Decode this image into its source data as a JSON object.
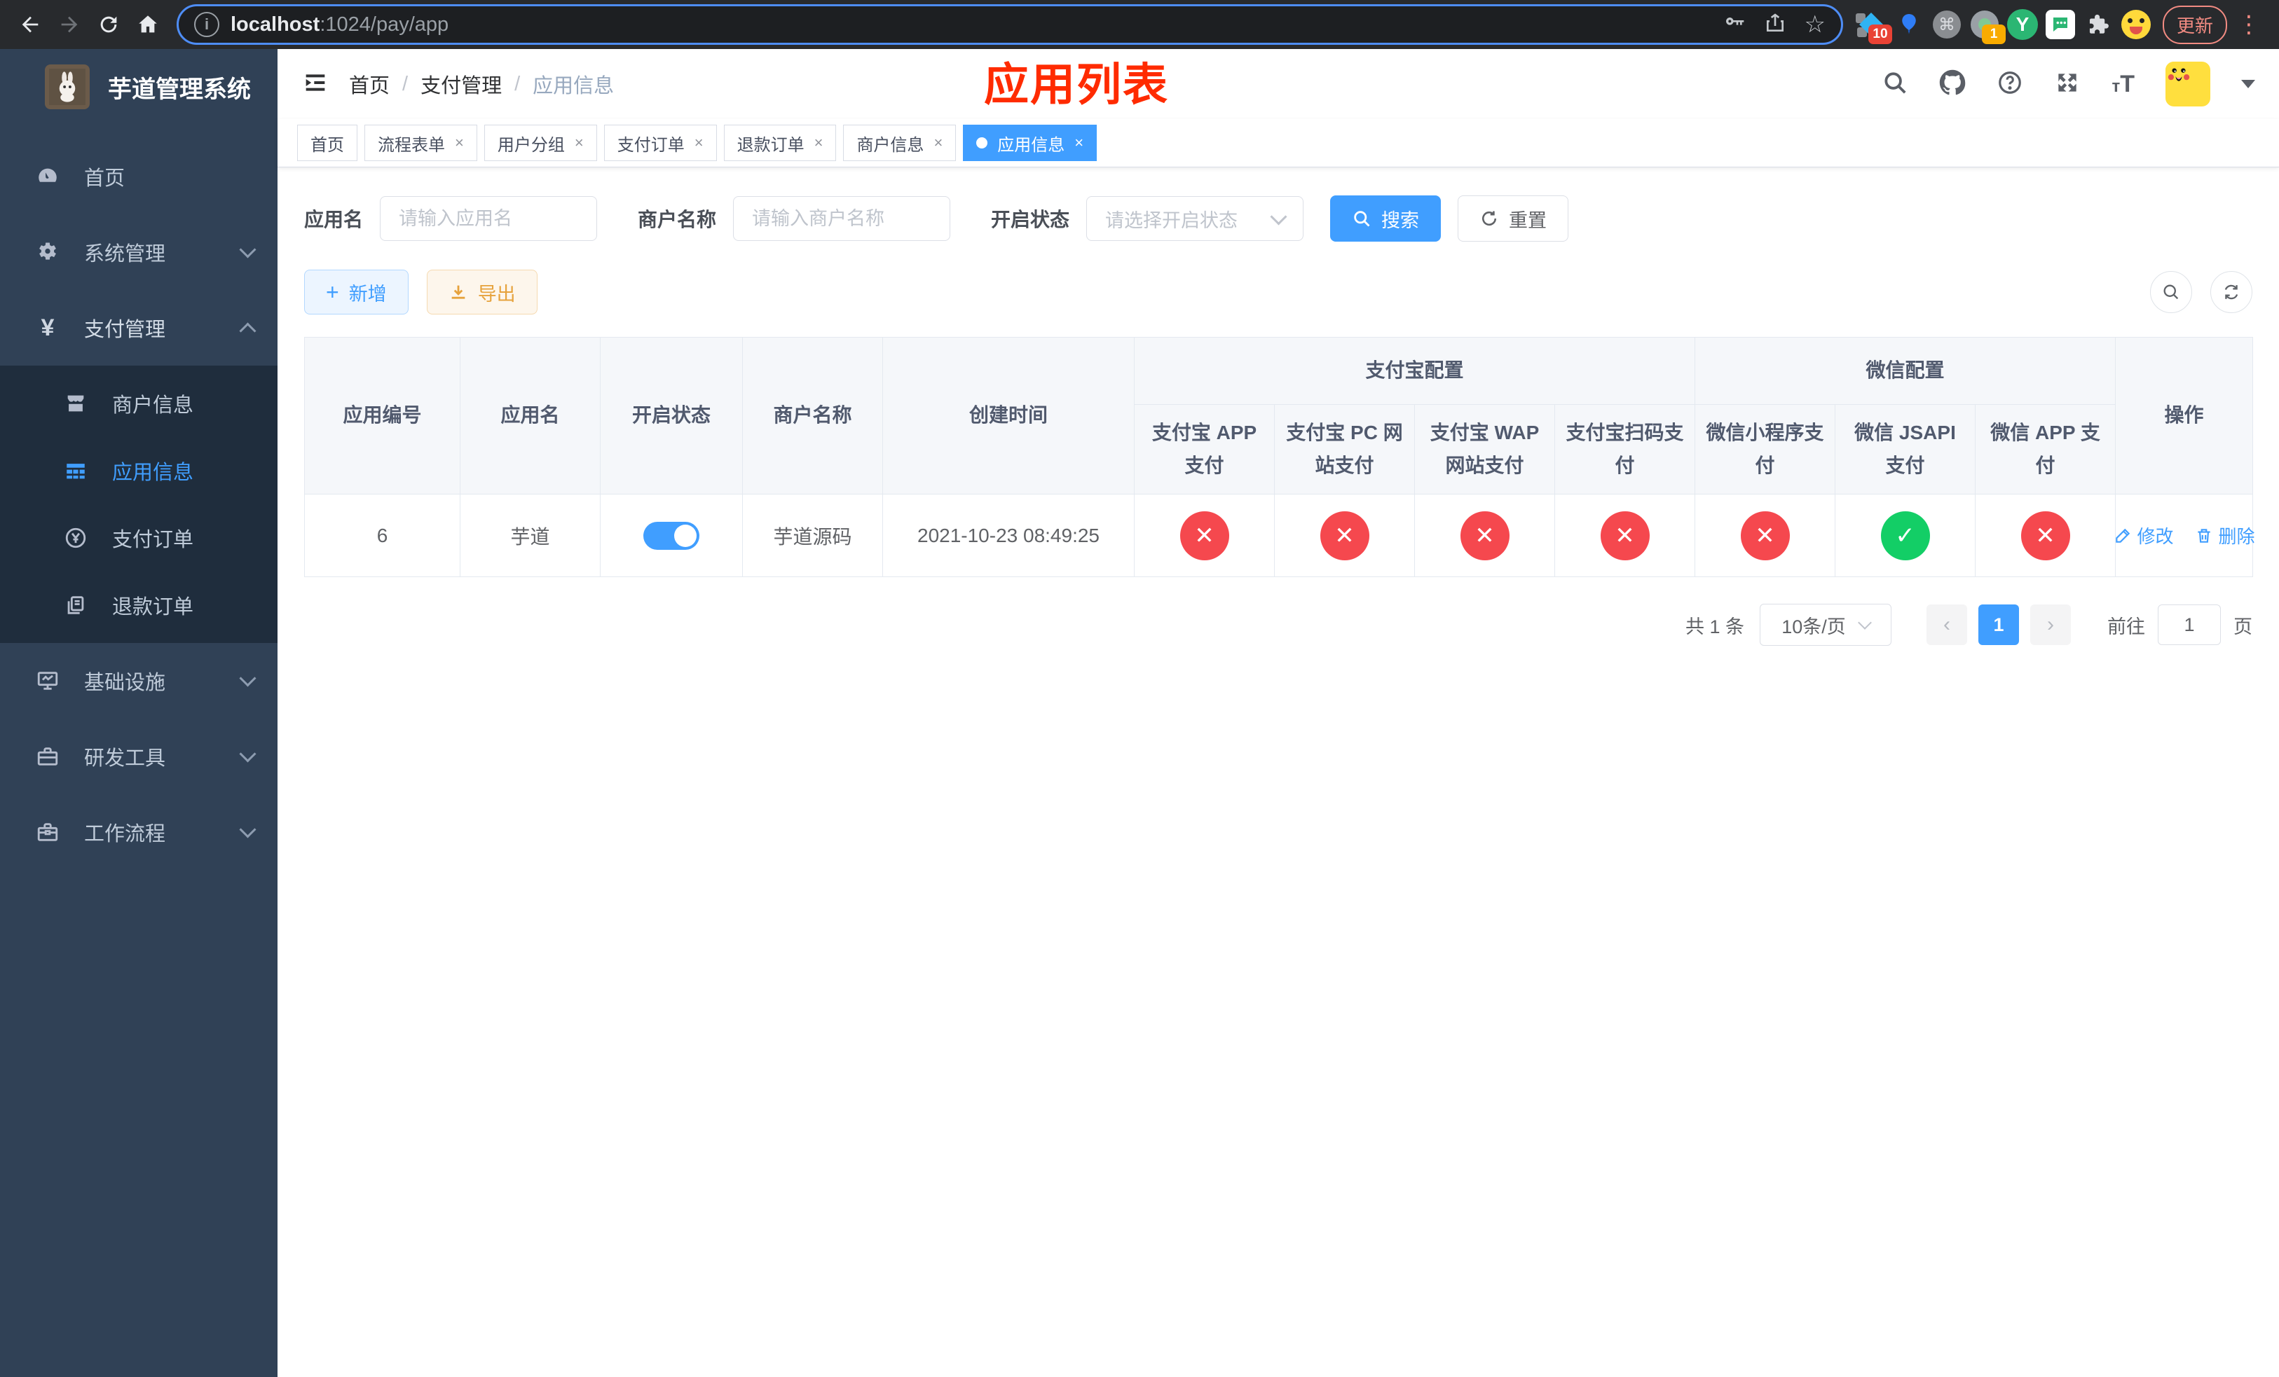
{
  "browser": {
    "url": {
      "host": "localhost",
      "path": ":1024/pay/app"
    },
    "update_label": "更新",
    "ext_badge_blue_diamond": "10",
    "ext_badge_camera": "1",
    "ext_y_letter": "Y"
  },
  "annotation": {
    "title": "应用列表",
    "color": "#ff2b00"
  },
  "sidebar": {
    "title": "芋道管理系统",
    "menu": [
      {
        "label": "首页"
      },
      {
        "label": "系统管理"
      },
      {
        "label": "支付管理"
      },
      {
        "label": "基础设施"
      },
      {
        "label": "研发工具"
      },
      {
        "label": "工作流程"
      }
    ],
    "submenu": [
      {
        "label": "商户信息"
      },
      {
        "label": "应用信息"
      },
      {
        "label": "支付订单"
      },
      {
        "label": "退款订单"
      }
    ]
  },
  "breadcrumb": {
    "sep": "/",
    "items": [
      {
        "label": "首页"
      },
      {
        "label": "支付管理"
      },
      {
        "label": "应用信息"
      }
    ]
  },
  "tabs": [
    {
      "label": "首页"
    },
    {
      "label": "流程表单"
    },
    {
      "label": "用户分组"
    },
    {
      "label": "支付订单"
    },
    {
      "label": "退款订单"
    },
    {
      "label": "商户信息"
    },
    {
      "label": "应用信息"
    }
  ],
  "icons": {
    "close": "×",
    "plus": "+",
    "prev": "‹",
    "next": "›",
    "star": "☆",
    "cmd": "⌘",
    "dots": "⋮",
    "info": "i"
  },
  "filters": {
    "app_name_label": "应用名",
    "app_name_placeholder": "请输入应用名",
    "merchant_label": "商户名称",
    "merchant_placeholder": "请输入商户名称",
    "status_label": "开启状态",
    "status_placeholder": "请选择开启状态",
    "search_label": "搜索",
    "reset_label": "重置"
  },
  "toolbar": {
    "add_label": "新增",
    "export_label": "导出"
  },
  "table": {
    "headers": {
      "app_id": "应用编号",
      "app_name": "应用名",
      "status": "开启状态",
      "merchant": "商户名称",
      "created": "创建时间",
      "alipay_group": "支付宝配置",
      "wechat_group": "微信配置",
      "alipay_app": "支付宝 APP 支付",
      "alipay_pc": "支付宝 PC 网站支付",
      "alipay_wap": "支付宝 WAP 网站支付",
      "alipay_scan": "支付宝扫码支付",
      "wx_mini": "微信小程序支付",
      "wx_jsapi": "微信 JSAPI 支付",
      "wx_app": "微信 APP 支付",
      "actions": "操作"
    },
    "row": {
      "id": "6",
      "name": "芋道",
      "enabled": true,
      "merchant": "芋道源码",
      "created": "2021-10-23 08:49:25",
      "flags": {
        "alipay_app": false,
        "alipay_pc": false,
        "alipay_wap": false,
        "alipay_scan": false,
        "wx_mini": false,
        "wx_jsapi": true,
        "wx_app": false
      },
      "edit_label": "修改",
      "delete_label": "删除"
    }
  },
  "pagination": {
    "total": "共 1 条",
    "page_size": "10条/页",
    "current_page": "1",
    "goto_label": "前往",
    "goto_value": "1",
    "unit_label": "页"
  },
  "colors": {
    "accent": "#409eff",
    "danger": "#f5484e",
    "success": "#13ce66",
    "sidebar_bg": "#304156",
    "submenu_bg": "#1f2d3d"
  }
}
